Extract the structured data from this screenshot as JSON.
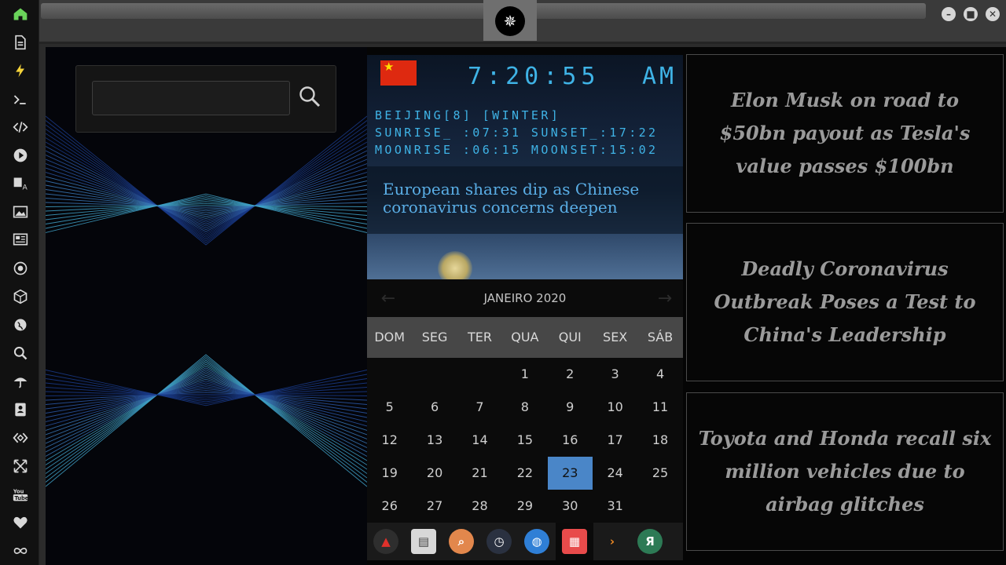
{
  "window": {
    "minimize_glyph": "–",
    "maximize_glyph": "■",
    "close_glyph": "✕",
    "emblem_icon": "rebel-alliance-icon"
  },
  "rail": {
    "icons": [
      "home-icon",
      "document-icon",
      "lightning-icon",
      "terminal-icon",
      "code-icon",
      "play-icon",
      "translate-icon",
      "image-icon",
      "newspaper-icon",
      "aperture-icon",
      "cube-icon",
      "globe-icon",
      "search-icon",
      "umbrella-icon",
      "contacts-icon",
      "dev-icon",
      "expand-icon",
      "youtube-icon",
      "heart-icon",
      "infinity-icon"
    ],
    "accent": "#6ad35a"
  },
  "search": {
    "value": "",
    "placeholder": ""
  },
  "clock": {
    "time": "7:20:55",
    "ampm": "AM",
    "location": "BEIJING[8] [WINTER]",
    "sun": "SUNRISE_ :07:31 SUNSET_:17:22",
    "moon": "MOONRISE :06:15 MOONSET:15:02",
    "ticker": "European shares dip as Chinese coronavirus concerns deepen",
    "color": "#3fb3e6"
  },
  "calendar": {
    "title": "JANEIRO 2020",
    "prev": "←",
    "next": "→",
    "weekdays": [
      "DOM",
      "SEG",
      "TER",
      "QUA",
      "QUI",
      "SEX",
      "SÁB"
    ],
    "weeks": [
      [
        "",
        "",
        "",
        "1",
        "2",
        "3",
        "4"
      ],
      [
        "5",
        "6",
        "7",
        "8",
        "9",
        "10",
        "11"
      ],
      [
        "12",
        "13",
        "14",
        "15",
        "16",
        "17",
        "18"
      ],
      [
        "19",
        "20",
        "21",
        "22",
        "23",
        "24",
        "25"
      ],
      [
        "26",
        "27",
        "28",
        "29",
        "30",
        "31",
        ""
      ]
    ],
    "today": "23",
    "today_color": "#4a86c8"
  },
  "dock": [
    {
      "icon": "launcher-icon",
      "glyph": "▲",
      "bg": "#2e2e2e",
      "fg": "#e0312b"
    },
    {
      "icon": "news-app-icon",
      "glyph": "▤",
      "bg": "#d8d8d8",
      "fg": "#444"
    },
    {
      "icon": "search-app-icon",
      "glyph": "⌕",
      "bg": "#e2874c",
      "fg": "#fff"
    },
    {
      "icon": "clock-app-icon",
      "glyph": "◷",
      "bg": "#2a3140",
      "fg": "#fff"
    },
    {
      "icon": "browser-icon",
      "glyph": "◍",
      "bg": "#2f7fd6",
      "fg": "#fff"
    },
    {
      "icon": "calendar-app-icon",
      "glyph": "▦",
      "bg": "#e84b4b",
      "fg": "#fff"
    },
    {
      "icon": "arrow-app-icon",
      "glyph": "›",
      "bg": "#1a1a1a",
      "fg": "#f08a24"
    },
    {
      "icon": "yandex-icon",
      "glyph": "Я",
      "bg": "#2d7a55",
      "fg": "#fff"
    }
  ],
  "news": [
    "Elon Musk on road to $50bn payout as Tesla's value passes $100bn",
    "Deadly Coronavirus Outbreak Poses a Test to China's Leadership",
    "Toyota and Honda recall six million vehicles due to airbag glitches"
  ]
}
